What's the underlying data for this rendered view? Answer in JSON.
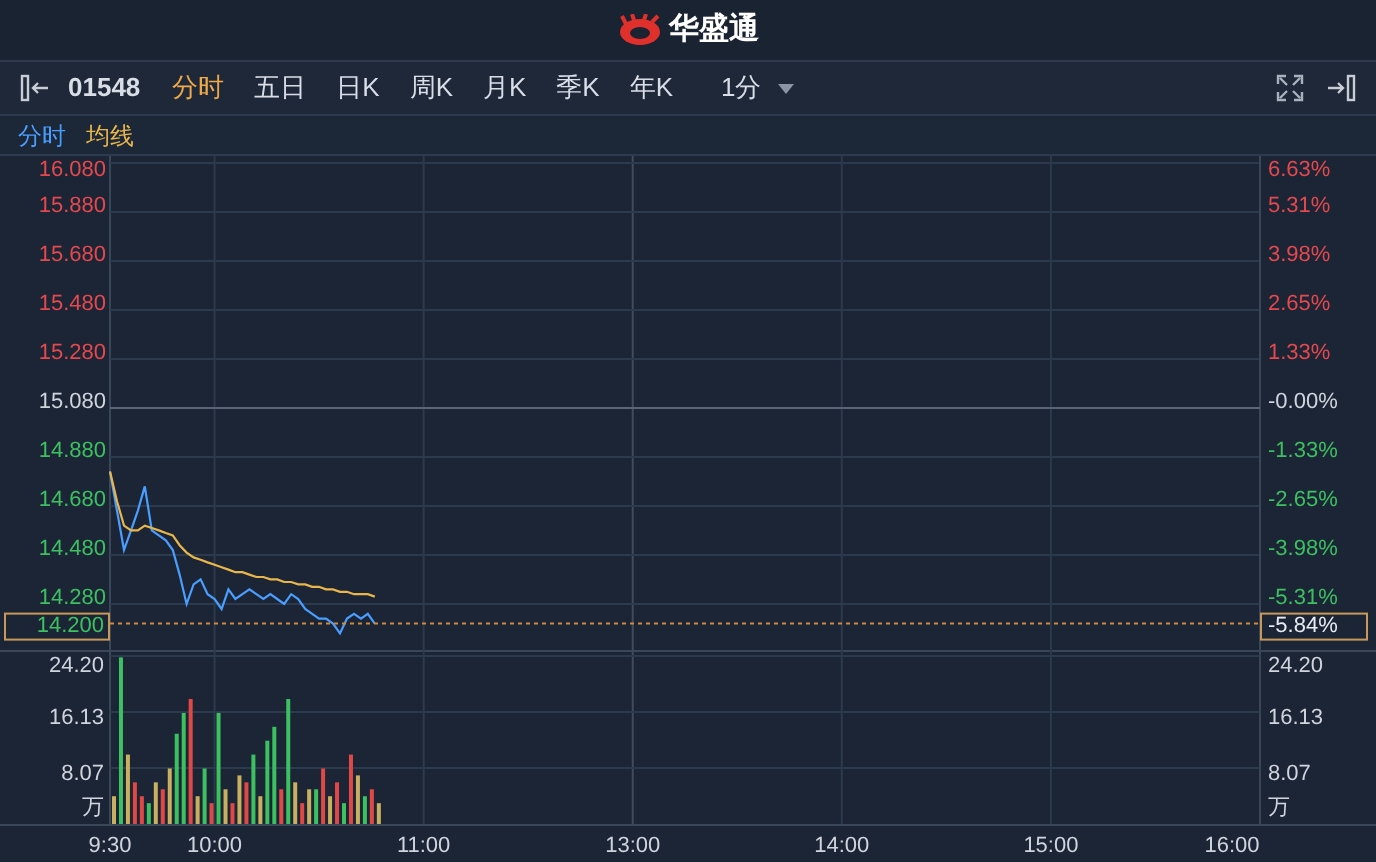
{
  "app": {
    "title": "华盛通"
  },
  "toolbar": {
    "symbol": "01548",
    "tabs": [
      {
        "label": "分时",
        "selected": true
      },
      {
        "label": "五日",
        "selected": false
      },
      {
        "label": "日K",
        "selected": false
      },
      {
        "label": "周K",
        "selected": false
      },
      {
        "label": "月K",
        "selected": false
      },
      {
        "label": "季K",
        "selected": false
      },
      {
        "label": "年K",
        "selected": false
      }
    ],
    "interval": {
      "label": "1分"
    }
  },
  "price_chart": {
    "chart_data": {
      "type": "line",
      "grid": true,
      "ylim": [
        14.08,
        16.08
      ],
      "categories": [
        null,
        null,
        null,
        null,
        null,
        null,
        null,
        null,
        null,
        null,
        null,
        null,
        null,
        null,
        null,
        null,
        null,
        null,
        null,
        null,
        null,
        null,
        null,
        null,
        null,
        null,
        null,
        null,
        null,
        null,
        null,
        null,
        null,
        null,
        null,
        null,
        null,
        null,
        null,
        null,
        null,
        null,
        null,
        null,
        null,
        null,
        null,
        null,
        null,
        null,
        null,
        null,
        null,
        null,
        null,
        null,
        null,
        null,
        null,
        null,
        null,
        null,
        null,
        null,
        null,
        null,
        null,
        null,
        null,
        null,
        null,
        null,
        null,
        null,
        null,
        null,
        null,
        null,
        null,
        null,
        null,
        null,
        null,
        null,
        null,
        null,
        null,
        null,
        null,
        null,
        null,
        null,
        null,
        null,
        null,
        null,
        null,
        null,
        null,
        null,
        null,
        null,
        null,
        null,
        null,
        null,
        null,
        null,
        null,
        null,
        null,
        null,
        null,
        null,
        null,
        null,
        null,
        null,
        null,
        null,
        null,
        null,
        null,
        null,
        null,
        null,
        null,
        null,
        null,
        null,
        null,
        null,
        null,
        null,
        null,
        null,
        null,
        null,
        null,
        null,
        null,
        null,
        null,
        null,
        null,
        null,
        null,
        null,
        null,
        null,
        null,
        null,
        null,
        null,
        null,
        null,
        null,
        null,
        null,
        null,
        null,
        null,
        null,
        null,
        null,
        null
      ],
      "yticks": [
        {
          "value": 16.08,
          "label": "16.080"
        },
        {
          "value": 15.88,
          "label": "15.880"
        },
        {
          "value": 15.68,
          "label": "15.680"
        },
        {
          "value": 15.48,
          "label": "15.480"
        },
        {
          "value": 15.28,
          "label": "15.280"
        },
        {
          "value": 15.08,
          "label": "15.080"
        },
        {
          "value": 14.88,
          "label": "14.880"
        },
        {
          "value": 14.68,
          "label": "14.680"
        },
        {
          "value": 14.48,
          "label": "14.480"
        },
        {
          "value": 14.28,
          "label": "14.280"
        }
      ],
      "ref_lines": [
        {
          "axis": "y",
          "value": 15.08
        },
        {
          "axis": "y",
          "value": 14.2
        }
      ],
      "series": [
        {
          "name": "分时",
          "color": "#4a9eff",
          "values": [
            14.82,
            14.66,
            14.5,
            14.58,
            14.66,
            14.76,
            14.58,
            14.56,
            14.54,
            14.5,
            14.4,
            14.28,
            14.36,
            14.38,
            14.32,
            14.3,
            14.26,
            14.34,
            14.3,
            14.32,
            14.34,
            14.32,
            14.3,
            14.32,
            14.3,
            14.28,
            14.32,
            14.3,
            14.26,
            14.24,
            14.22,
            14.22,
            14.2,
            14.16,
            14.22,
            14.24,
            14.22,
            14.24,
            14.2,
            null,
            null,
            null,
            null,
            null,
            null,
            null,
            null,
            null,
            null,
            null,
            null,
            null,
            null,
            null,
            null,
            null,
            null,
            null,
            null,
            null,
            null,
            null,
            null,
            null,
            null,
            null,
            null,
            null,
            null,
            null,
            null,
            null,
            null,
            null,
            null,
            null,
            null,
            null,
            null,
            null,
            null,
            null,
            null,
            null,
            null,
            null,
            null,
            null,
            null,
            null,
            null,
            null,
            null,
            null,
            null,
            null,
            null,
            null,
            null,
            null,
            null,
            null,
            null,
            null,
            null,
            null,
            null,
            null,
            null,
            null,
            null,
            null,
            null,
            null,
            null,
            null,
            null,
            null,
            null,
            null,
            null,
            null,
            null,
            null,
            null,
            null,
            null,
            null,
            null,
            null,
            null,
            null,
            null,
            null,
            null,
            null,
            null,
            null,
            null,
            null,
            null,
            null,
            null,
            null,
            null,
            null,
            null,
            null,
            null,
            null,
            null,
            null,
            null,
            null,
            null,
            null,
            null,
            null,
            null,
            null,
            null,
            null,
            null,
            null,
            null,
            null
          ]
        },
        {
          "name": "均线",
          "color": "#e8b64a",
          "values": [
            14.82,
            14.7,
            14.6,
            14.58,
            14.58,
            14.6,
            14.59,
            14.58,
            14.57,
            14.56,
            14.52,
            14.49,
            14.47,
            14.46,
            14.45,
            14.44,
            14.43,
            14.42,
            14.41,
            14.41,
            14.4,
            14.39,
            14.39,
            14.38,
            14.38,
            14.37,
            14.37,
            14.36,
            14.36,
            14.35,
            14.35,
            14.34,
            14.34,
            14.33,
            14.33,
            14.32,
            14.32,
            14.32,
            14.31,
            null,
            null,
            null,
            null,
            null,
            null,
            null,
            null,
            null,
            null,
            null,
            null,
            null,
            null,
            null,
            null,
            null,
            null,
            null,
            null,
            null,
            null,
            null,
            null,
            null,
            null,
            null,
            null,
            null,
            null,
            null,
            null,
            null,
            null,
            null,
            null,
            null,
            null,
            null,
            null,
            null,
            null,
            null,
            null,
            null,
            null,
            null,
            null,
            null,
            null,
            null,
            null,
            null,
            null,
            null,
            null,
            null,
            null,
            null,
            null,
            null,
            null,
            null,
            null,
            null,
            null,
            null,
            null,
            null,
            null,
            null,
            null,
            null,
            null,
            null,
            null,
            null,
            null,
            null,
            null,
            null,
            null,
            null,
            null,
            null,
            null,
            null,
            null,
            null,
            null,
            null,
            null,
            null,
            null,
            null,
            null,
            null,
            null,
            null,
            null,
            null,
            null,
            null,
            null,
            null,
            null,
            null,
            null,
            null,
            null,
            null,
            null,
            null,
            null,
            null,
            null,
            null,
            null,
            null,
            null,
            null,
            null,
            null,
            null,
            null,
            null,
            null
          ]
        }
      ]
    },
    "right_axis": [
      {
        "label": "6.63%",
        "kind": "up"
      },
      {
        "label": "5.31%",
        "kind": "up"
      },
      {
        "label": "3.98%",
        "kind": "up"
      },
      {
        "label": "2.65%",
        "kind": "up"
      },
      {
        "label": "1.33%",
        "kind": "up"
      },
      {
        "label": "-0.00%",
        "kind": "flat"
      },
      {
        "label": "-1.33%",
        "kind": "down"
      },
      {
        "label": "-2.65%",
        "kind": "down"
      },
      {
        "label": "-3.98%",
        "kind": "down"
      },
      {
        "label": "-5.31%",
        "kind": "down"
      }
    ],
    "current_price": {
      "price": "14.200",
      "change": "-5.84%"
    }
  },
  "volume_chart": {
    "chart_data": {
      "type": "bar",
      "stacked": true,
      "grid": true,
      "ylabel": "万",
      "ylim": [
        0,
        24.2
      ],
      "categories": [
        "9:30",
        null,
        null,
        null,
        null,
        null,
        null,
        null,
        null,
        null,
        null,
        null,
        null,
        null,
        null,
        "10:00",
        null,
        null,
        null,
        null,
        null,
        null,
        null,
        null,
        null,
        null,
        null,
        null,
        null,
        null,
        null,
        null,
        null,
        null,
        null,
        null,
        null,
        null,
        null,
        null,
        null,
        null,
        null,
        null,
        null,
        "11:00",
        null,
        null,
        null,
        null,
        null,
        null,
        null,
        null,
        null,
        null,
        null,
        null,
        null,
        null,
        null,
        null,
        null,
        null,
        null,
        null,
        null,
        null,
        null,
        null,
        null,
        null,
        null,
        null,
        null,
        "13:00",
        null,
        null,
        null,
        null,
        null,
        null,
        null,
        null,
        null,
        null,
        null,
        null,
        null,
        null,
        null,
        null,
        null,
        null,
        null,
        null,
        null,
        null,
        null,
        null,
        null,
        null,
        null,
        null,
        null,
        "14:00",
        null,
        null,
        null,
        null,
        null,
        null,
        null,
        null,
        null,
        null,
        null,
        null,
        null,
        null,
        null,
        null,
        null,
        null,
        null,
        null,
        null,
        null,
        null,
        null,
        null,
        null,
        null,
        null,
        null,
        "15:00",
        null,
        null,
        null,
        null,
        null,
        null,
        null,
        null,
        null,
        null,
        null,
        null,
        null,
        null,
        null,
        null,
        null,
        null,
        null,
        null,
        null,
        null,
        null,
        null,
        null,
        null,
        null,
        null,
        null,
        "16:00"
      ],
      "yticks": [
        {
          "value": 24.2,
          "label": "24.20"
        },
        {
          "value": 16.13,
          "label": "16.13"
        },
        {
          "value": 8.07,
          "label": "8.07"
        }
      ],
      "series": [
        {
          "color": "#e04848",
          "values": [
            null,
            null,
            null,
            6,
            4,
            null,
            null,
            5,
            null,
            null,
            null,
            18,
            null,
            null,
            3,
            null,
            null,
            3,
            null,
            6,
            null,
            null,
            null,
            null,
            5,
            null,
            null,
            3,
            null,
            null,
            8,
            null,
            6,
            null,
            10,
            null,
            null,
            5,
            null,
            null,
            null,
            null,
            null,
            null,
            null,
            null,
            null,
            null,
            null,
            null,
            null,
            null,
            null,
            null,
            null,
            null,
            null,
            null,
            null,
            null,
            null,
            null,
            null,
            null,
            null,
            null,
            null,
            null,
            null,
            null,
            null,
            null,
            null,
            null,
            null,
            null,
            null,
            null,
            null,
            null,
            null,
            null,
            null,
            null,
            null,
            null,
            null,
            null,
            null,
            null,
            null,
            null,
            null,
            null,
            null,
            null,
            null,
            null,
            null,
            null,
            null,
            null,
            null,
            null,
            null,
            null,
            null,
            null,
            null,
            null,
            null,
            null,
            null,
            null,
            null,
            null,
            null,
            null,
            null,
            null,
            null,
            null,
            null,
            null,
            null,
            null,
            null,
            null,
            null,
            null,
            null,
            null,
            null,
            null,
            null,
            null,
            null,
            null,
            null,
            null,
            null,
            null,
            null,
            null,
            null,
            null,
            null,
            null,
            null,
            null,
            null,
            null,
            null,
            null,
            null,
            null,
            null,
            null,
            null,
            null,
            null,
            null,
            null,
            null,
            null,
            null
          ]
        },
        {
          "color": "#3cc060",
          "values": [
            null,
            24,
            null,
            null,
            null,
            3,
            null,
            null,
            null,
            13,
            16,
            null,
            null,
            8,
            null,
            16,
            null,
            null,
            null,
            null,
            10,
            null,
            12,
            14,
            null,
            18,
            null,
            null,
            null,
            5,
            null,
            null,
            null,
            3,
            null,
            null,
            4,
            null,
            null,
            null,
            null,
            null,
            null,
            null,
            null,
            null,
            null,
            null,
            null,
            null,
            null,
            null,
            null,
            null,
            null,
            null,
            null,
            null,
            null,
            null,
            null,
            null,
            null,
            null,
            null,
            null,
            null,
            null,
            null,
            null,
            null,
            null,
            null,
            null,
            null,
            null,
            null,
            null,
            null,
            null,
            null,
            null,
            null,
            null,
            null,
            null,
            null,
            null,
            null,
            null,
            null,
            null,
            null,
            null,
            null,
            null,
            null,
            null,
            null,
            null,
            null,
            null,
            null,
            null,
            null,
            null,
            null,
            null,
            null,
            null,
            null,
            null,
            null,
            null,
            null,
            null,
            null,
            null,
            null,
            null,
            null,
            null,
            null,
            null,
            null,
            null,
            null,
            null,
            null,
            null,
            null,
            null,
            null,
            null,
            null,
            null,
            null,
            null,
            null,
            null,
            null,
            null,
            null,
            null,
            null,
            null,
            null,
            null,
            null,
            null,
            null,
            null,
            null,
            null,
            null,
            null,
            null,
            null,
            null,
            null,
            null,
            null,
            null,
            null,
            null,
            null
          ]
        },
        {
          "color": "#c8b060",
          "values": [
            4,
            null,
            10,
            null,
            null,
            null,
            6,
            null,
            8,
            null,
            null,
            null,
            4,
            null,
            null,
            null,
            5,
            null,
            7,
            null,
            null,
            4,
            null,
            null,
            null,
            null,
            6,
            null,
            5,
            null,
            null,
            4,
            null,
            null,
            null,
            7,
            null,
            null,
            3,
            null,
            null,
            null,
            null,
            null,
            null,
            null,
            null,
            null,
            null,
            null,
            null,
            null,
            null,
            null,
            null,
            null,
            null,
            null,
            null,
            null,
            null,
            null,
            null,
            null,
            null,
            null,
            null,
            null,
            null,
            null,
            null,
            null,
            null,
            null,
            null,
            null,
            null,
            null,
            null,
            null,
            null,
            null,
            null,
            null,
            null,
            null,
            null,
            null,
            null,
            null,
            null,
            null,
            null,
            null,
            null,
            null,
            null,
            null,
            null,
            null,
            null,
            null,
            null,
            null,
            null,
            null,
            null,
            null,
            null,
            null,
            null,
            null,
            null,
            null,
            null,
            null,
            null,
            null,
            null,
            null,
            null,
            null,
            null,
            null,
            null,
            null,
            null,
            null,
            null,
            null,
            null,
            null,
            null,
            null,
            null,
            null,
            null,
            null,
            null,
            null,
            null,
            null,
            null,
            null,
            null,
            null,
            null,
            null,
            null,
            null,
            null,
            null,
            null,
            null,
            null,
            null,
            null,
            null,
            null,
            null,
            null,
            null,
            null,
            null,
            null,
            null
          ]
        }
      ]
    },
    "right_axis": [
      "24.20",
      "16.13",
      "8.07",
      "万"
    ]
  }
}
